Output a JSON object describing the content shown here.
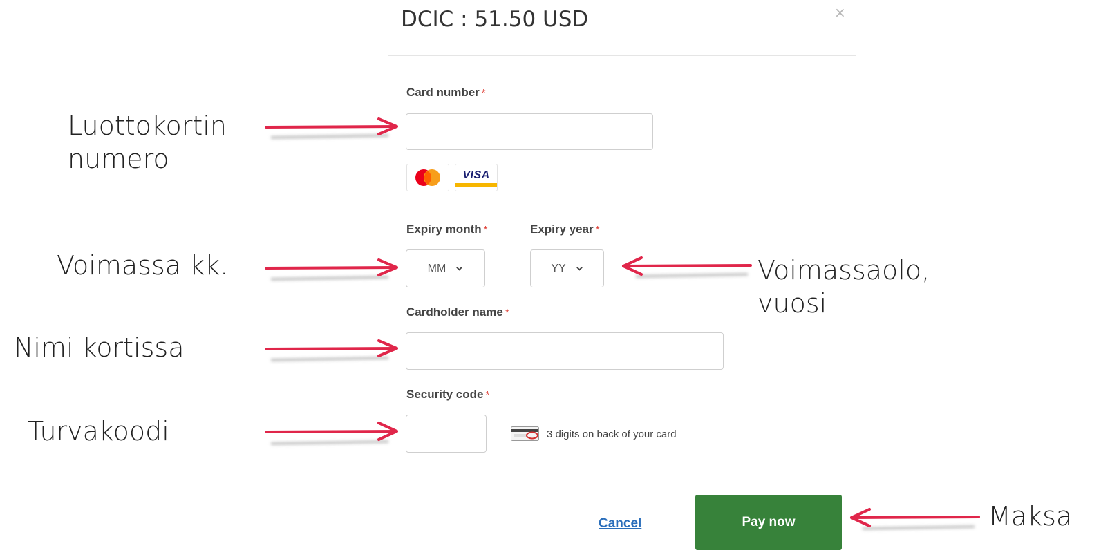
{
  "modal": {
    "title": "DCIC : 51.50 USD",
    "close_symbol": "×"
  },
  "form": {
    "card_number": {
      "label": "Card number",
      "required_mark": "*",
      "value": ""
    },
    "card_brands": {
      "mastercard": "mastercard-icon",
      "visa": "VISA"
    },
    "expiry_month": {
      "label": "Expiry month",
      "required_mark": "*",
      "selected": "MM"
    },
    "expiry_year": {
      "label": "Expiry year",
      "required_mark": "*",
      "selected": "YY"
    },
    "cardholder_name": {
      "label": "Cardholder name",
      "required_mark": "*",
      "value": ""
    },
    "security_code": {
      "label": "Security code",
      "required_mark": "*",
      "value": "",
      "hint": "3 digits on back of your card"
    }
  },
  "actions": {
    "cancel_label": "Cancel",
    "pay_label": "Pay now"
  },
  "annotations": {
    "card_number": [
      "Luottokortin",
      "numero"
    ],
    "expiry_month": "Voimassa kk.",
    "expiry_year": [
      "Voimassaolo,",
      "vuosi"
    ],
    "cardholder_name": "Nimi kortissa",
    "security_code": "Turvakoodi",
    "pay": "Maksa"
  },
  "colors": {
    "arrow": "#e0264a",
    "pay_button": "#37823a",
    "link": "#2a6ebb",
    "required": "#e0433a"
  }
}
